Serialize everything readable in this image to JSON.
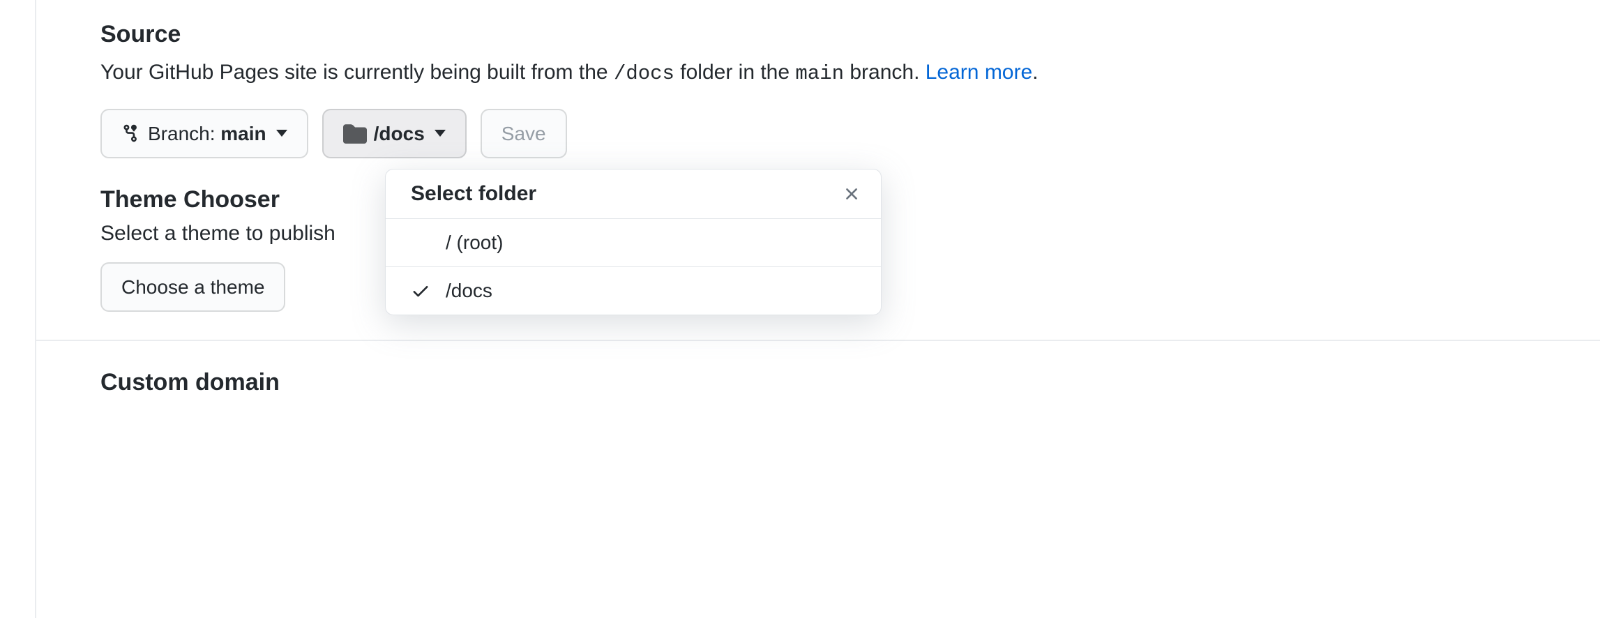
{
  "source": {
    "heading": "Source",
    "desc_prefix": "Your GitHub Pages site is currently being built from the ",
    "desc_code1": "/docs",
    "desc_mid": " folder in the ",
    "desc_code2": "main",
    "desc_suffix": " branch. ",
    "learn_more": "Learn more",
    "desc_period": ".",
    "branch_label": "Branch: ",
    "branch_value": "main",
    "folder_value": "/docs",
    "save_label": "Save"
  },
  "dropdown": {
    "title": "Select folder",
    "items": [
      {
        "label": "/ (root)",
        "selected": false
      },
      {
        "label": "/docs",
        "selected": true
      }
    ]
  },
  "theme": {
    "heading": "Theme Chooser",
    "desc": "Select a theme to publish",
    "button": "Choose a theme"
  },
  "custom_domain": {
    "heading": "Custom domain"
  }
}
